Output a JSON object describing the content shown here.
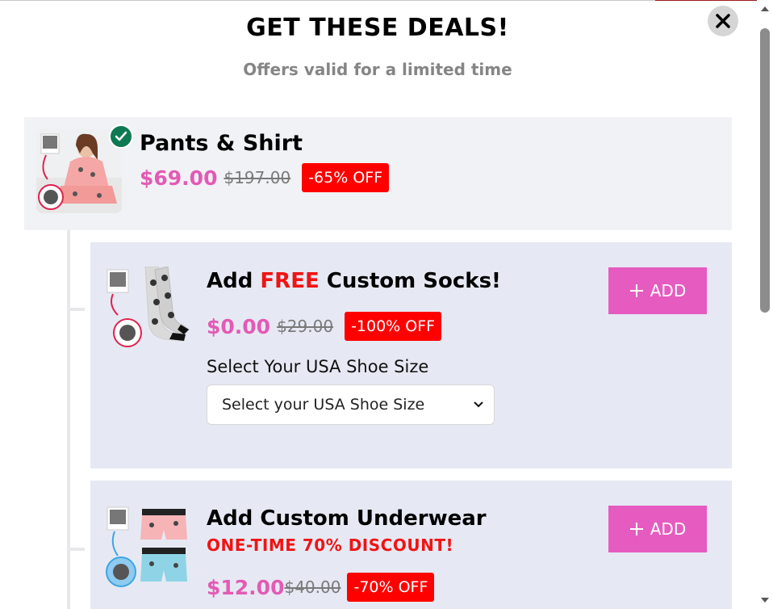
{
  "header": {
    "title": "GET THESE DEALS!",
    "subtitle": "Offers valid for a limited time"
  },
  "main_product": {
    "name": "Pants & Shirt",
    "price": "$69.00",
    "old_price": "$197.00",
    "discount": "-65% OFF"
  },
  "addons": [
    {
      "title_prefix": "Add ",
      "title_highlight": "FREE",
      "title_suffix": " Custom Socks!",
      "price": "$0.00",
      "old_price": "$29.00",
      "discount": "-100% OFF",
      "add_label": "ADD",
      "size_label": "Select Your USA Shoe Size",
      "size_select_value": "Select your USA Shoe Size"
    },
    {
      "title": "Add Custom Underwear",
      "promo": "ONE-TIME 70% DISCOUNT!",
      "price": "$12.00",
      "old_price": "$40.00",
      "discount": "-70% OFF",
      "add_label": "ADD"
    }
  ],
  "icons": {
    "close": "close-icon",
    "check": "check-icon",
    "plus": "plus-icon",
    "chevron": "chevron-down-icon"
  },
  "colors": {
    "price_pink": "#e45ab5",
    "add_button": "#e65bc0",
    "discount_red": "#ff0000",
    "check_green": "#0f7a52"
  }
}
